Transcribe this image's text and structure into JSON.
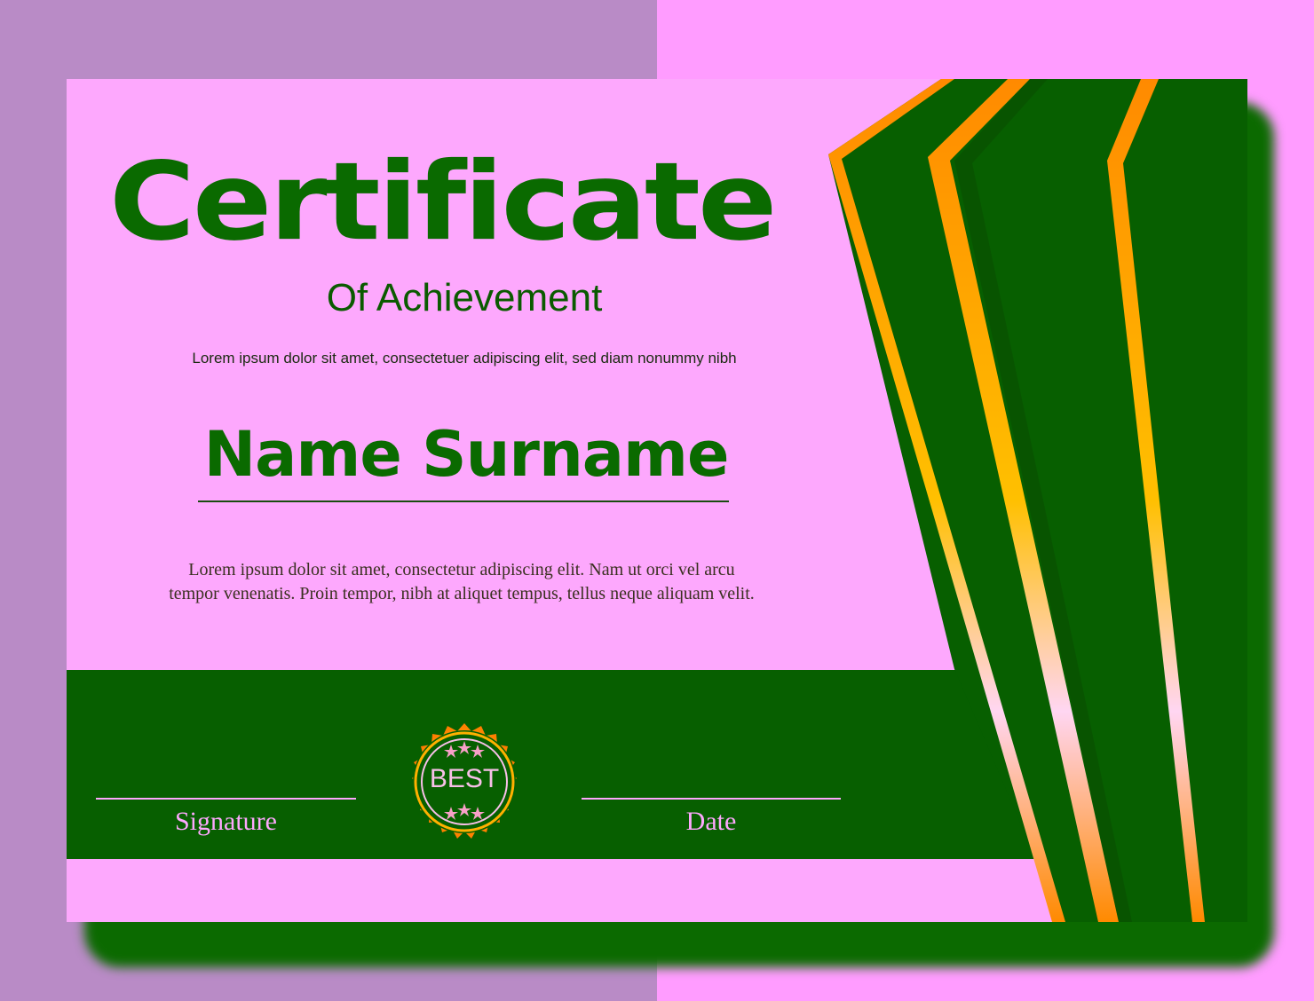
{
  "certificate": {
    "title": "Certificate",
    "subtitle": "Of Achievement",
    "intro_text": "Lorem ipsum dolor sit amet, consectetuer adipiscing elit, sed diam nonummy nibh",
    "recipient_name": "Name Surname",
    "body_text_line1": "Lorem ipsum dolor  sit  amet,  consectetur adipiscing  elit. Nam ut orci vel arcu",
    "body_text_line2": "tempor venenatis. Proin tempor, nibh at aliquet tempus, tellus neque aliquam velit.",
    "signature_label": "Signature",
    "date_label": "Date",
    "seal_text": "BEST"
  },
  "colors": {
    "background": "#ff9cff",
    "background_left": "#b98bc6",
    "card": "#fda8fd",
    "green": "#075f00",
    "gold": "#ffa500",
    "orange": "#ff6a00"
  },
  "icons": {
    "seal": "award-seal-icon",
    "stars": "star-icon"
  }
}
